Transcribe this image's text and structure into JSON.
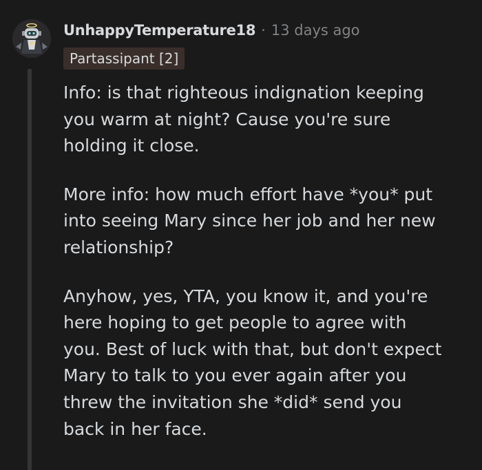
{
  "comment": {
    "author": "UnhappyTemperature18",
    "separator": "·",
    "timestamp": "13 days ago",
    "flair": "Partassipant [2]",
    "avatar_icon": "robot-avatar-icon",
    "paragraphs": [
      {
        "lines": [
          "Info: is that righteous indignation keeping",
          "you warm at night? Cause you're sure",
          "holding it close."
        ]
      },
      {
        "lines": [
          "More info: how much effort have *you* put",
          "into seeing Mary since her job and her new",
          "relationship?"
        ]
      },
      {
        "lines": [
          "Anyhow, yes, YTA, you know it, and you're",
          "here hoping to get people to agree with",
          "you. Best of luck with that, but don't expect",
          "Mary to talk to you ever again after you",
          "threw the invitation she *did* send you",
          "back in her face."
        ]
      }
    ]
  },
  "colors": {
    "background": "#1a1a1b",
    "text": "#d7dadc",
    "muted": "#818384",
    "flair_bg": "#3a2e2a",
    "thread_line": "#343536"
  }
}
